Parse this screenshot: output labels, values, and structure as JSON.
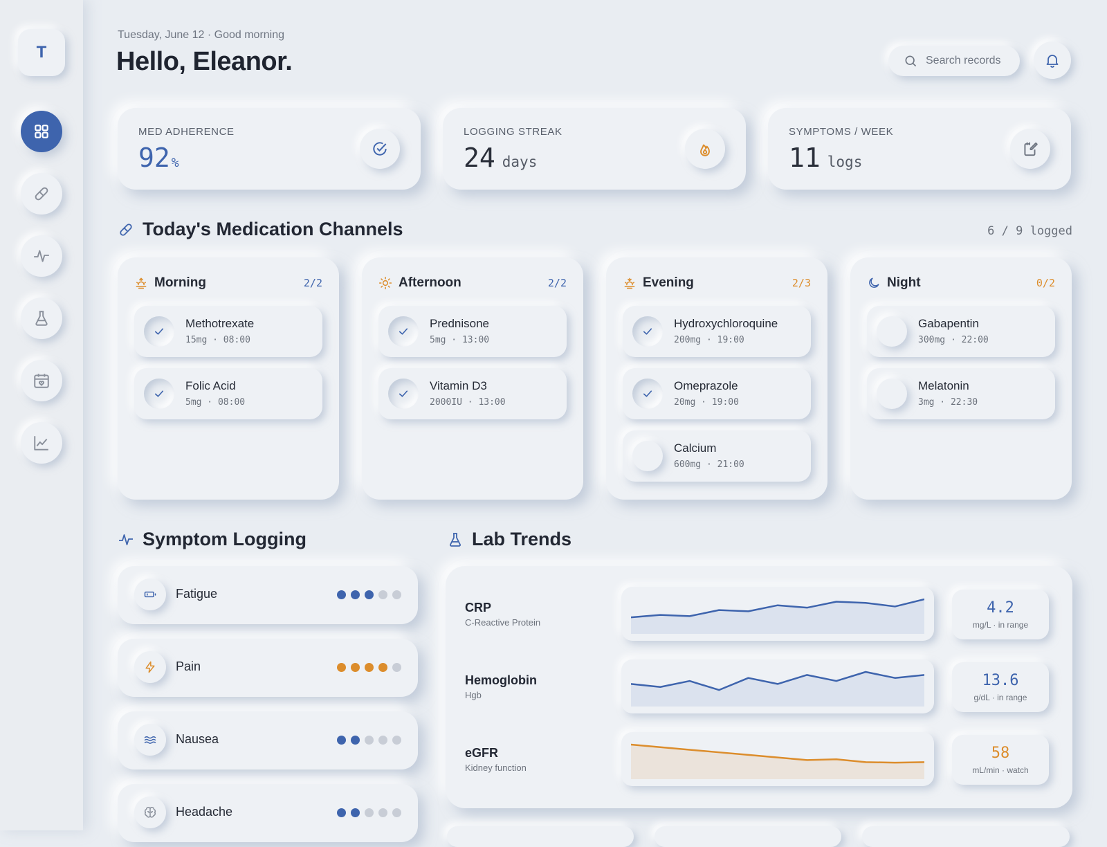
{
  "app": {
    "logo_letter": "T"
  },
  "header": {
    "date_line": "Tuesday, June 12 · Good morning",
    "greeting": "Hello, Eleanor.",
    "search_placeholder": "Search records"
  },
  "sidebar": {
    "items": [
      {
        "name": "dashboard",
        "icon": "grid-icon",
        "active": true
      },
      {
        "name": "medications",
        "icon": "pill-icon"
      },
      {
        "name": "symptoms",
        "icon": "pulse-icon"
      },
      {
        "name": "labs",
        "icon": "flask-icon"
      },
      {
        "name": "calendar",
        "icon": "calendar-heart-icon"
      },
      {
        "name": "trends",
        "icon": "chart-line-icon"
      }
    ]
  },
  "stats": [
    {
      "label": "MED ADHERENCE",
      "value": "92",
      "unit": "%",
      "icon": "check-circle-icon",
      "color": "#3e64ad"
    },
    {
      "label": "LOGGING STREAK",
      "value": "24",
      "unit": "days",
      "icon": "flame-icon",
      "color": "#2a2f3a"
    },
    {
      "label": "SYMPTOMS / WEEK",
      "value": "11",
      "unit": "logs",
      "icon": "note-edit-icon",
      "color": "#2a2f3a"
    }
  ],
  "medication_section": {
    "title": "Today's Medication Channels",
    "logged_summary": "6 / 9 logged",
    "channels": [
      {
        "name": "Morning",
        "count": "2/2",
        "icon": "sunrise-icon",
        "status_color": "#3e64ad",
        "meds": [
          {
            "name": "Methotrexate",
            "dose": "15mg  ·  08:00",
            "taken": true
          },
          {
            "name": "Folic Acid",
            "dose": "5mg  ·  08:00",
            "taken": true
          }
        ]
      },
      {
        "name": "Afternoon",
        "count": "2/2",
        "icon": "sun-icon",
        "status_color": "#3e64ad",
        "meds": [
          {
            "name": "Prednisone",
            "dose": "5mg  ·  13:00",
            "taken": true
          },
          {
            "name": "Vitamin D3",
            "dose": "2000IU  ·  13:00",
            "taken": true
          }
        ]
      },
      {
        "name": "Evening",
        "count": "2/3",
        "icon": "sunset-icon",
        "status_color": "#dc8d2c",
        "meds": [
          {
            "name": "Hydroxychloroquine",
            "dose": "200mg  ·  19:00",
            "taken": true
          },
          {
            "name": "Omeprazole",
            "dose": "20mg  ·  19:00",
            "taken": true
          },
          {
            "name": "Calcium",
            "dose": "600mg  ·  21:00",
            "taken": false
          }
        ]
      },
      {
        "name": "Night",
        "count": "0/2",
        "icon": "moon-icon",
        "status_color": "#dc8d2c",
        "meds": [
          {
            "name": "Gabapentin",
            "dose": "300mg  ·  22:00",
            "taken": false
          },
          {
            "name": "Melatonin",
            "dose": "3mg  ·  22:30",
            "taken": false
          }
        ]
      }
    ]
  },
  "symptom_section": {
    "title": "Symptom Logging",
    "items": [
      {
        "name": "Fatigue",
        "icon": "battery-icon",
        "level": 3,
        "color": "#3e64ad"
      },
      {
        "name": "Pain",
        "icon": "bolt-icon",
        "level": 4,
        "color": "#dc8d2c"
      },
      {
        "name": "Nausea",
        "icon": "waves-icon",
        "level": 2,
        "color": "#3e64ad"
      },
      {
        "name": "Headache",
        "icon": "brain-icon",
        "level": 2,
        "color": "#3e64ad"
      }
    ],
    "max_level": 5
  },
  "lab_section": {
    "title": "Lab Trends",
    "rows": [
      {
        "name": "CRP",
        "sub": "C-Reactive Protein",
        "value": "4.2",
        "note": "mg/L · in range",
        "color": "#3e64ad",
        "trend": [
          2.3,
          2.5,
          2.4,
          2.9,
          2.8,
          3.3,
          3.1,
          3.6,
          3.5,
          3.2,
          3.8
        ]
      },
      {
        "name": "Hemoglobin",
        "sub": "Hgb",
        "value": "13.6",
        "note": "g/dL · in range",
        "color": "#3e64ad",
        "trend": [
          13.0,
          12.9,
          13.1,
          12.8,
          13.2,
          13.0,
          13.3,
          13.1,
          13.4,
          13.2,
          13.3
        ]
      },
      {
        "name": "eGFR",
        "sub": "Kidney function",
        "value": "58",
        "note": "mL/min · watch",
        "color": "#dc8d2c",
        "trend": [
          64,
          63,
          62,
          61,
          60,
          59,
          58,
          58.3,
          57.2,
          57,
          57.2
        ]
      }
    ]
  }
}
